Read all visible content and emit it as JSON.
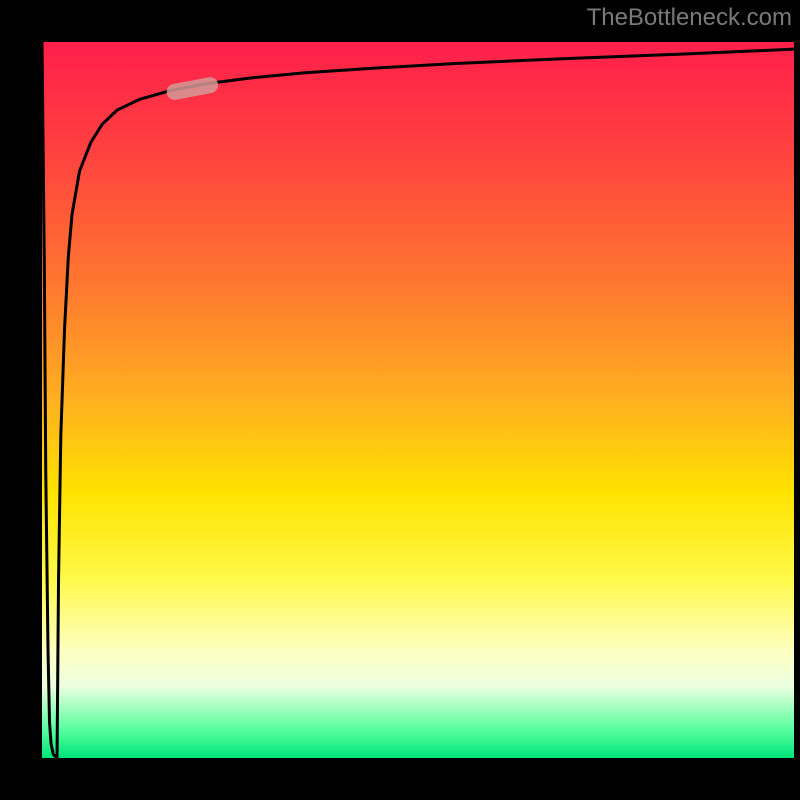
{
  "watermark": {
    "text": "TheBottleneck.com"
  },
  "chart_data": {
    "type": "line",
    "title": "",
    "xlabel": "",
    "ylabel": "",
    "xlim": [
      0,
      100
    ],
    "ylim": [
      0,
      100
    ],
    "grid": false,
    "background_gradient": {
      "direction": "vertical",
      "stops": [
        {
          "pos": 0.0,
          "color": "#ff1f4b"
        },
        {
          "pos": 0.35,
          "color": "#ff7b2e"
        },
        {
          "pos": 0.63,
          "color": "#ffe300"
        },
        {
          "pos": 0.85,
          "color": "#fdffc0"
        },
        {
          "pos": 0.96,
          "color": "#58ff9e"
        },
        {
          "pos": 1.0,
          "color": "#00e57a"
        }
      ]
    },
    "series": [
      {
        "name": "curve-down",
        "x": [
          0.0,
          0.3,
          0.5,
          0.8,
          1.0,
          1.2,
          1.5,
          2.0
        ],
        "y": [
          100,
          70,
          40,
          15,
          5,
          2,
          0.5,
          0
        ]
      },
      {
        "name": "curve-up",
        "x": [
          2.0,
          2.2,
          2.5,
          3.0,
          3.5,
          4.0,
          5.0,
          6.5,
          8.0,
          10,
          13,
          17,
          22,
          28,
          35,
          45,
          55,
          70,
          85,
          100
        ],
        "y": [
          0,
          25,
          45,
          60,
          70,
          76,
          82,
          86,
          88.5,
          90.5,
          92,
          93.2,
          94.2,
          95,
          95.7,
          96.4,
          97,
          97.7,
          98.3,
          99
        ]
      }
    ],
    "marker": {
      "shape": "pill",
      "center_x": 20,
      "center_y": 93.5,
      "color": "#d39a96",
      "opacity": 0.85
    }
  }
}
